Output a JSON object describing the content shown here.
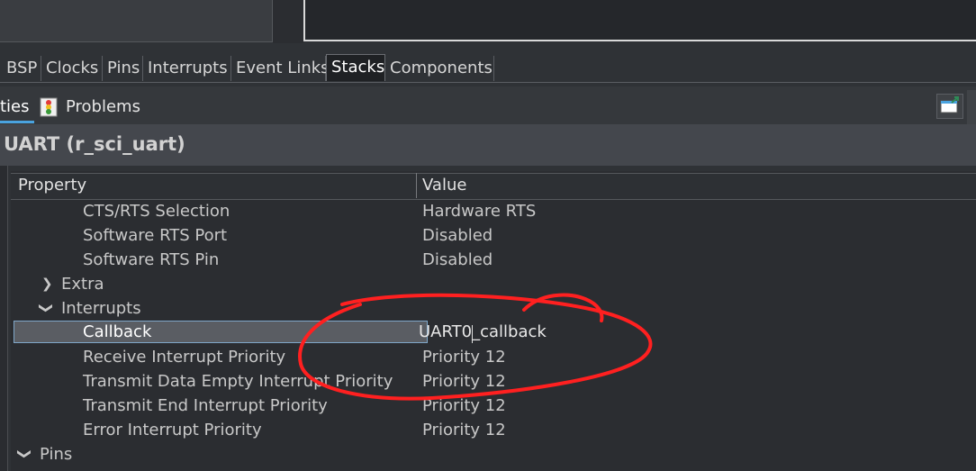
{
  "config_tabs": [
    "BSP",
    "Clocks",
    "Pins",
    "Interrupts",
    "Event Links",
    "Stacks",
    "Components"
  ],
  "active_config_tab": "Stacks",
  "view_tabs": {
    "properties_partial": "ties",
    "problems": "Problems"
  },
  "panel_title": "UART (r_sci_uart)",
  "table": {
    "headers": {
      "property": "Property",
      "value": "Value"
    },
    "rows": [
      {
        "property": "CTS/RTS Selection",
        "value": "Hardware RTS"
      },
      {
        "property": "Software RTS Port",
        "value": "Disabled"
      },
      {
        "property": "Software RTS Pin",
        "value": "Disabled"
      },
      {
        "property": "Extra",
        "value": ""
      },
      {
        "property": "Interrupts",
        "value": ""
      },
      {
        "property": "Callback",
        "value": "UART0_callback"
      },
      {
        "property": "Receive Interrupt Priority",
        "value": "Priority 12"
      },
      {
        "property": "Transmit Data Empty Interrupt Priority",
        "value": "Priority 12"
      },
      {
        "property": "Transmit End Interrupt Priority",
        "value": "Priority 12"
      },
      {
        "property": "Error Interrupt Priority",
        "value": "Priority 12"
      },
      {
        "property": "Pins",
        "value": ""
      }
    ]
  },
  "colors": {
    "annotation": "#ff2020",
    "selection": "#5a5d63",
    "accent": "#4aa3df"
  }
}
